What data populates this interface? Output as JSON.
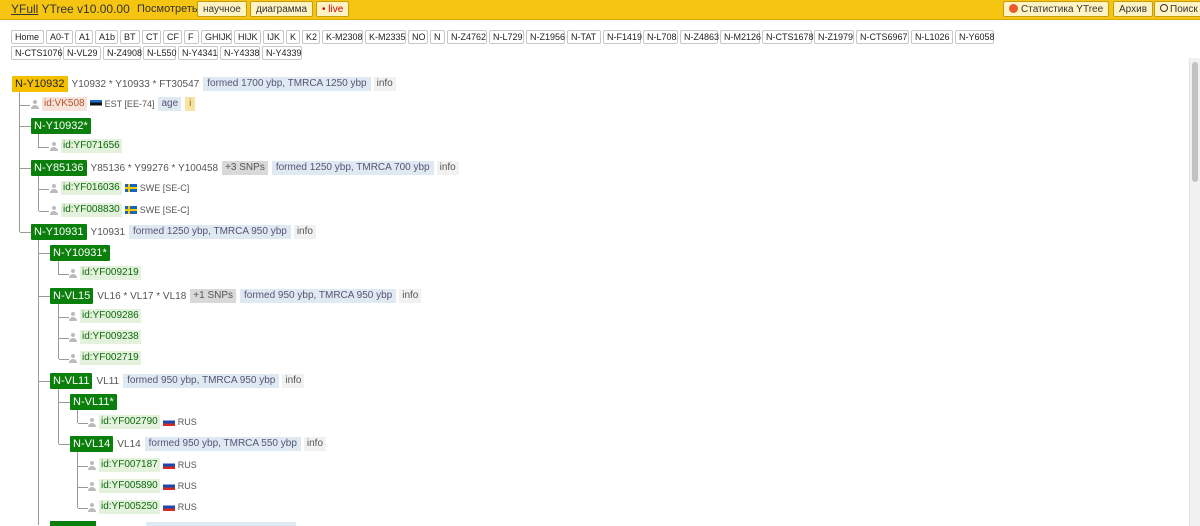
{
  "topbar": {
    "brand_link": "YFull",
    "brand_rest": "YTree v10.00.00",
    "view_label": "Посмотреть:",
    "btn_scientific": "научное",
    "btn_diagram": "диаграмма",
    "btn_live": "• live",
    "btn_stats": "Статистика YTree",
    "btn_archive": "Архив",
    "btn_search": "Поиск"
  },
  "nav": [
    "Home",
    "A0-T",
    "A1",
    "A1b",
    "BT",
    "CT",
    "CF",
    "F",
    "GHIJK",
    "HIJK",
    "IJK",
    "K",
    "K2",
    "K-M2308",
    "K-M2335",
    "NO",
    "N",
    "N-Z4762",
    "N-L729",
    "N-Z1956",
    "N-TAT",
    "N-F1419",
    "N-L708",
    "N-Z4863",
    "N-M2126",
    "N-CTS1678",
    "N-Z1979",
    "N-CTS6967",
    "N-L1026",
    "N-Y6058",
    "N-CTS10760",
    "N-VL29",
    "N-Z4908",
    "N-L550",
    "N-Y4341",
    "N-Y4338",
    "N-Y4339"
  ],
  "tree": {
    "root": {
      "name": "N-Y10932",
      "snps": "Y10932 * Y10933 * FT30547",
      "formed": "formed 1700 ybp, TMRCA 1250 ybp",
      "info": "info"
    },
    "ancient": {
      "id": "id:VK508",
      "country": "EST [EE-74]",
      "age": "age",
      "i": "i"
    },
    "n_y10932s": {
      "name": "N-Y10932*"
    },
    "yf071656": {
      "id": "id:YF071656"
    },
    "n_y85136": {
      "name": "N-Y85136",
      "snps": "Y85136 * Y99276 * Y100458",
      "extra": "+3 SNPs",
      "formed": "formed 1250 ybp, TMRCA 700 ybp",
      "info": "info"
    },
    "yf016036": {
      "id": "id:YF016036",
      "country": "SWE [SE-C]"
    },
    "yf008830": {
      "id": "id:YF008830",
      "country": "SWE [SE-C]"
    },
    "n_y10931": {
      "name": "N-Y10931",
      "snps": "Y10931",
      "formed": "formed 1250 ybp, TMRCA 950 ybp",
      "info": "info"
    },
    "n_y10931s": {
      "name": "N-Y10931*"
    },
    "yf009219": {
      "id": "id:YF009219"
    },
    "n_vl15": {
      "name": "N-VL15",
      "snps": "VL16 * VL17 * VL18",
      "extra": "+1 SNPs",
      "formed": "formed 950 ybp, TMRCA 950 ybp",
      "info": "info"
    },
    "yf009286": {
      "id": "id:YF009286"
    },
    "yf009238": {
      "id": "id:YF009238"
    },
    "yf002719": {
      "id": "id:YF002719"
    },
    "n_vl11": {
      "name": "N-VL11",
      "snps": "VL11",
      "formed": "formed 950 ybp, TMRCA 950 ybp",
      "info": "info"
    },
    "n_vl11s": {
      "name": "N-VL11*"
    },
    "yf002790": {
      "id": "id:YF002790",
      "country": "RUS"
    },
    "n_vl14": {
      "name": "N-VL14",
      "snps": "VL14",
      "formed": "formed 950 ybp, TMRCA 550 ybp",
      "info": "info"
    },
    "yf007187": {
      "id": "id:YF007187",
      "country": "RUS"
    },
    "yf005890": {
      "id": "id:YF005890",
      "country": "RUS"
    },
    "yf005250": {
      "id": "id:YF005250",
      "country": "RUS"
    }
  }
}
